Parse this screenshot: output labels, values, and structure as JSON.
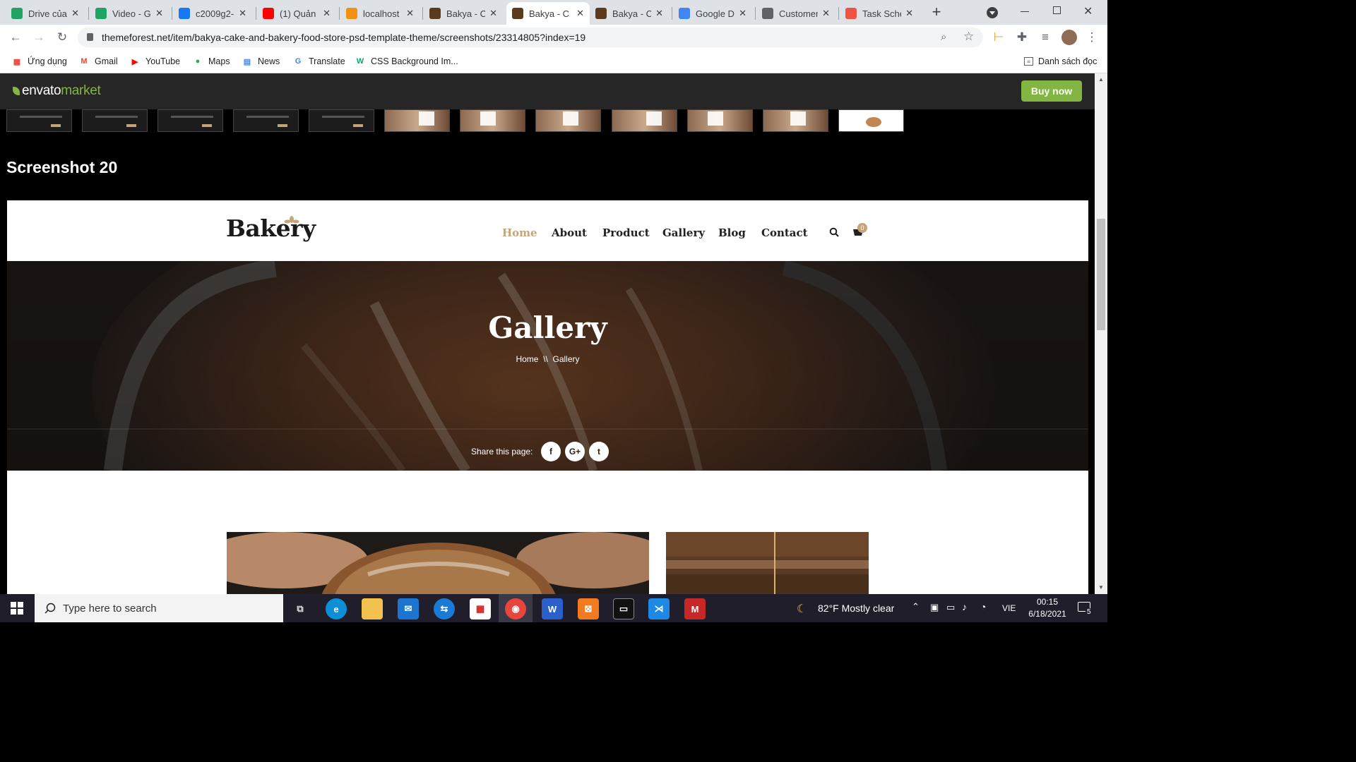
{
  "browser": {
    "tabs": [
      {
        "title": "Drive của",
        "icon": "google-drive-icon",
        "color": "#1fa463"
      },
      {
        "title": "Video - G",
        "icon": "google-drive-icon",
        "color": "#1fa463"
      },
      {
        "title": "c2009g2-",
        "icon": "facebook-icon",
        "color": "#1877f2"
      },
      {
        "title": "(1) Quản",
        "icon": "youtube-icon",
        "color": "#ff0000"
      },
      {
        "title": "localhost",
        "icon": "phpmyadmin-icon",
        "color": "#f29111"
      },
      {
        "title": "Bakya - C",
        "icon": "bakya-icon",
        "color": "#5b3a1e"
      },
      {
        "title": "Bakya - C",
        "icon": "bakya-icon",
        "color": "#5b3a1e"
      },
      {
        "title": "Bakya - C",
        "icon": "bakya-icon",
        "color": "#5b3a1e"
      },
      {
        "title": "Google D",
        "icon": "google-translate-icon",
        "color": "#4285f4"
      },
      {
        "title": "Customer",
        "icon": "globe-icon",
        "color": "#5f6368"
      },
      {
        "title": "Task Sche",
        "icon": "laravel-icon",
        "color": "#f05340"
      }
    ],
    "active_tab_index": 6,
    "url": "themeforest.net/item/bakya-cake-and-bakery-food-store-psd-template-theme/screenshots/23314805?index=19",
    "bookmarks": [
      {
        "label": "Ứng dụng",
        "icon": "apps-grid-icon"
      },
      {
        "label": "Gmail",
        "icon": "gmail-icon"
      },
      {
        "label": "YouTube",
        "icon": "youtube-icon"
      },
      {
        "label": "Maps",
        "icon": "maps-icon"
      },
      {
        "label": "News",
        "icon": "news-icon"
      },
      {
        "label": "Translate",
        "icon": "translate-icon"
      },
      {
        "label": "CSS Background Im...",
        "icon": "w3schools-icon"
      }
    ],
    "reading_list": "Danh sách đọc"
  },
  "envato": {
    "logo_word": "envato",
    "logo_suffix": "market",
    "buy_now": "Buy now",
    "brand_green": "#82b541"
  },
  "screenshot_heading": "Screenshot 20",
  "site": {
    "logo": "Bakery",
    "nav": [
      "Home",
      "About",
      "Product",
      "Gallery",
      "Blog",
      "Contact"
    ],
    "active_nav": "Home",
    "accent": "#c4a579",
    "cart_count": "0",
    "hero": {
      "title": "Gallery",
      "breadcrumb_home": "Home",
      "breadcrumb_sep": "\\\\",
      "breadcrumb_current": "Gallery",
      "share_label": "Share this page:",
      "social": [
        {
          "glyph": "f",
          "icon": "facebook-icon"
        },
        {
          "glyph": "G+",
          "icon": "google-plus-icon"
        },
        {
          "glyph": "t",
          "icon": "twitter-icon"
        }
      ]
    }
  },
  "taskbar": {
    "search_placeholder": "Type here to search",
    "weather": "82°F  Mostly clear",
    "language": "VIE",
    "time": "00:15",
    "date": "6/18/2021",
    "notification_count": "5"
  }
}
